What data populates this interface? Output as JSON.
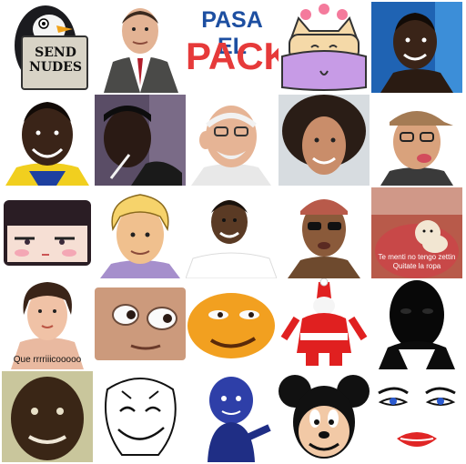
{
  "title_sticker": {
    "line1": "PASA EL",
    "line2": "PACK"
  },
  "penguin_sign": {
    "line1": "SEND",
    "line2": "NUDES"
  },
  "woman_caption": "Que rrrriiicooooo",
  "dog_caption": {
    "line1": "Te menti no tengo zettin",
    "line2": "Quitate la ropa"
  },
  "stickers": [
    {
      "name": "penguin-send-nudes-sticker"
    },
    {
      "name": "suited-man-sticker"
    },
    {
      "name": "pasa-el-pack-title-sticker"
    },
    {
      "name": "pink-cat-sticker"
    },
    {
      "name": "smiling-man-blue-bg-sticker"
    },
    {
      "name": "smiling-man-yellow-shirt-sticker"
    },
    {
      "name": "man-with-straw-sticker"
    },
    {
      "name": "old-man-glasses-sticker"
    },
    {
      "name": "curly-hair-man-sticker"
    },
    {
      "name": "man-with-cap-sticker"
    },
    {
      "name": "anime-face-sticker"
    },
    {
      "name": "cartoon-hero-sticker"
    },
    {
      "name": "smiling-man-sticker"
    },
    {
      "name": "man-sunglasses-sticker"
    },
    {
      "name": "dog-caption-sticker"
    },
    {
      "name": "woman-caption-sticker"
    },
    {
      "name": "wide-eyes-face-sticker"
    },
    {
      "name": "orange-face-sticker"
    },
    {
      "name": "santa-sticker"
    },
    {
      "name": "dark-face-sticker"
    },
    {
      "name": "grinning-man-sticker"
    },
    {
      "name": "meme-face-sticker"
    },
    {
      "name": "blue-figure-sticker"
    },
    {
      "name": "cartoon-mouse-sticker"
    },
    {
      "name": "drawn-eyes-lips-sticker"
    }
  ],
  "colors": {
    "title_blue": "#1d4fa1",
    "title_red": "#e63a3a",
    "cat_pink": "#f2c6e6",
    "cat_purple": "#c79be6"
  }
}
